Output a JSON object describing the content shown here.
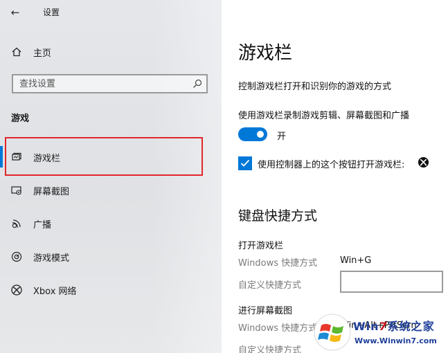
{
  "window": {
    "back_glyph": "←",
    "title": "设置"
  },
  "sidebar": {
    "home": {
      "label": "主页",
      "icon": "home-icon"
    },
    "search": {
      "placeholder": "查找设置",
      "icon": "search-icon"
    },
    "section_label": "游戏",
    "items": [
      {
        "label": "游戏栏",
        "icon": "game-bar-icon",
        "active": true
      },
      {
        "label": "屏幕截图",
        "icon": "screen-capture-icon",
        "active": false
      },
      {
        "label": "广播",
        "icon": "broadcast-icon",
        "active": false
      },
      {
        "label": "游戏模式",
        "icon": "game-mode-icon",
        "active": false
      },
      {
        "label": "Xbox 网络",
        "icon": "xbox-icon",
        "active": false
      }
    ]
  },
  "main": {
    "title": "游戏栏",
    "description": "控制游戏栏打开和识别你的游戏的方式",
    "record": {
      "label": "使用游戏栏录制游戏剪辑、屏幕截图和广播",
      "toggle_on": true,
      "toggle_state_label": "开"
    },
    "controller": {
      "checked": true,
      "label": "使用控制器上的这个按钮打开游戏栏:",
      "icon": "xbox-button-icon"
    },
    "shortcuts": {
      "heading": "键盘快捷方式",
      "groups": [
        {
          "title": "打开游戏栏",
          "windows_label": "Windows 快捷方式",
          "windows_value": "Win+G",
          "custom_label": "自定义快捷方式",
          "custom_value": ""
        },
        {
          "title": "进行屏幕截图",
          "windows_label": "Windows 快捷方式",
          "windows_value": "Win+Alt+PrtScrn",
          "custom_label": "自定义快捷方式",
          "custom_value": ""
        }
      ]
    }
  },
  "watermark": {
    "prefix": "Win",
    "seven": "7",
    "suffix": "系统之家",
    "url": "Www.Winwin7.com"
  },
  "colors": {
    "accent": "#0078d7",
    "highlight_border": "#e0262a",
    "sidebar_bg": "#e1e3e6"
  }
}
